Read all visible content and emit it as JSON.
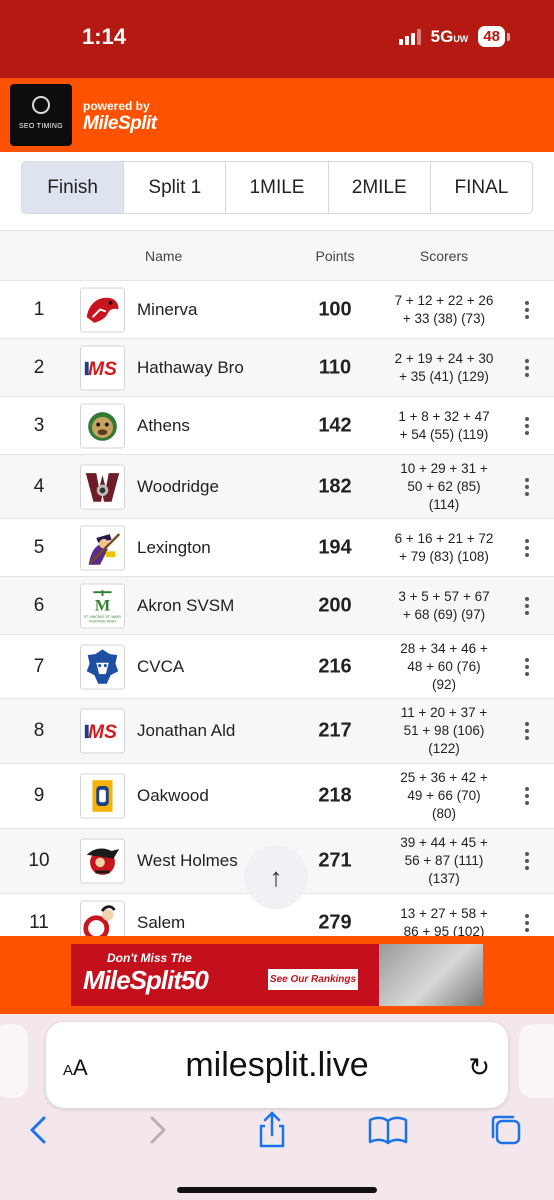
{
  "status_bar": {
    "time": "1:14",
    "network": "5G",
    "network_suffix": "UW",
    "battery": "48"
  },
  "brand": {
    "logo_text": "SEO TIMING",
    "powered_by": "powered by",
    "name": "MileSplit"
  },
  "tabs": [
    {
      "label": "Finish",
      "active": true
    },
    {
      "label": "Split 1",
      "active": false
    },
    {
      "label": "1MILE",
      "active": false
    },
    {
      "label": "2MILE",
      "active": false
    },
    {
      "label": "FINAL",
      "active": false
    }
  ],
  "table": {
    "headers": {
      "name": "Name",
      "points": "Points",
      "scorers": "Scorers"
    },
    "rows": [
      {
        "place": "1",
        "team": "Minerva",
        "points": "100",
        "scorers": [
          "7 + 12 + 22 + 26",
          "+ 33 (38) (73)"
        ],
        "logo": "minerva-lion-logo"
      },
      {
        "place": "2",
        "team": "Hathaway Bro",
        "points": "110",
        "scorers": [
          "2 + 19 + 24 + 30",
          "+ 35 (41) (129)"
        ],
        "logo": "ms-logo"
      },
      {
        "place": "3",
        "team": "Athens",
        "points": "142",
        "scorers": [
          "1 + 8 + 32 + 47",
          "+ 54 (55) (119)"
        ],
        "logo": "athens-bulldog-logo"
      },
      {
        "place": "4",
        "team": "Woodridge",
        "points": "182",
        "scorers": [
          "10 + 29 + 31 +",
          "50 + 62 (85)",
          "(114)"
        ],
        "logo": "woodridge-w-logo"
      },
      {
        "place": "5",
        "team": "Lexington",
        "points": "194",
        "scorers": [
          "6 + 16 + 21 + 72",
          "+ 79 (83) (108)"
        ],
        "logo": "lexington-minuteman-logo"
      },
      {
        "place": "6",
        "team": "Akron SVSM",
        "points": "200",
        "scorers": [
          "3 + 5 + 57 + 67",
          "+ 68 (69) (97)"
        ],
        "logo": "svsm-logo",
        "logo_text": "ST. VINCENT-ST. MARY FIGHTING IRISH"
      },
      {
        "place": "7",
        "team": "CVCA",
        "points": "216",
        "scorers": [
          "28 + 34 + 46 +",
          "48 + 60 (76)",
          "(92)"
        ],
        "logo": "cvca-lion-logo"
      },
      {
        "place": "8",
        "team": "Jonathan Ald",
        "points": "217",
        "scorers": [
          "11 + 20 + 37 +",
          "51 + 98 (106)",
          "(122)"
        ],
        "logo": "ms-logo"
      },
      {
        "place": "9",
        "team": "Oakwood",
        "points": "218",
        "scorers": [
          "25 + 36 + 42 +",
          "49 + 66 (70)",
          "(80)"
        ],
        "logo": "oakwood-o-logo"
      },
      {
        "place": "10",
        "team": "West Holmes",
        "points": "271",
        "scorers": [
          "39 + 44 + 45 +",
          "56 + 87 (111)",
          "(137)"
        ],
        "logo": "west-holmes-logo"
      },
      {
        "place": "11",
        "team": "Salem",
        "points": "279",
        "scorers": [
          "13 + 27 + 58 +",
          "86 + 95 (102)"
        ],
        "logo": "salem-logo"
      }
    ]
  },
  "scroll_top_icon": "arrow-up-icon",
  "ad": {
    "line1": "Don't Miss The",
    "line2": "MileSplit50",
    "cta": "See Our Rankings"
  },
  "browser": {
    "text_size_label": "AA",
    "url": "milesplit.live",
    "toolbar": [
      "back-icon",
      "forward-icon",
      "share-icon",
      "bookmarks-icon",
      "tabs-icon"
    ]
  },
  "colors": {
    "status_bar": "#b41a12",
    "brand_orange": "#ff5200",
    "active_tab": "#dde3ef",
    "browser_bg": "#f3e7ec",
    "toolbar_blue": "#1a73e8"
  }
}
